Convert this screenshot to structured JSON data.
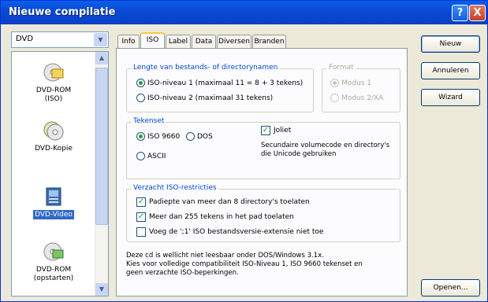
{
  "window": {
    "title": "Nieuwe compilatie"
  },
  "titlebar_buttons": {
    "help": "?",
    "close": "X"
  },
  "disc_combo": {
    "value": "DVD"
  },
  "compilation_types": [
    {
      "label": "DVD-ROM\n(ISO)",
      "icon": "disc-folder-icon"
    },
    {
      "label": "DVD-Kopie",
      "icon": "disc-copy-icon"
    },
    {
      "label": "DVD-Video",
      "icon": "dvd-video-icon",
      "selected": true
    },
    {
      "label": "DVD-ROM\n(opstarten)",
      "icon": "disc-boot-icon"
    }
  ],
  "tabs": [
    {
      "label": "Info"
    },
    {
      "label": "ISO",
      "active": true
    },
    {
      "label": "Label"
    },
    {
      "label": "Data"
    },
    {
      "label": "Diversen"
    },
    {
      "label": "Branden"
    }
  ],
  "iso_tab": {
    "length_group": {
      "label": "Lengte van bestands- of directorynamen",
      "options": [
        "ISO-niveau 1 (maximaal 11 = 8 + 3 tekens)",
        "ISO-niveau 2 (maximaal 31 tekens)"
      ]
    },
    "format_group": {
      "label": "Format",
      "options": [
        "Modus 1",
        "Modus 2/XA"
      ]
    },
    "charset_group": {
      "label": "Tekenset",
      "iso9660": "ISO 9660",
      "dos": "DOS",
      "ascii": "ASCII",
      "joliet": "Joliet",
      "joliet_note": "Secundaire volumecode en directory's die Unicode gebruiken"
    },
    "relaxed_group": {
      "label": "Verzacht ISO-restricties",
      "options": [
        {
          "label": "Padiepte van meer dan 8 directory's toelaten",
          "checked": true
        },
        {
          "label": "Meer dan 255 tekens in het pad toelaten",
          "checked": true
        },
        {
          "label": "Voeg de ';1' ISO bestandsversie-extensie niet toe",
          "checked": false
        }
      ]
    },
    "footer_note": "Deze cd is wellicht niet leesbaar onder DOS/Windows 3.1x.\nKies voor volledige compatibiliteit ISO-Niveau 1, ISO 9660 tekenset en\ngeen verzachte ISO-beperkingen."
  },
  "buttons": {
    "new": "Nieuw",
    "cancel": "Annuleren",
    "wizard": "Wizard",
    "open": "Openen..."
  },
  "colors": {
    "titlebar": "#0a4ad6",
    "selection": "#316ac5",
    "group_label": "#0046d5",
    "tab_highlight": "#ffc83c"
  }
}
